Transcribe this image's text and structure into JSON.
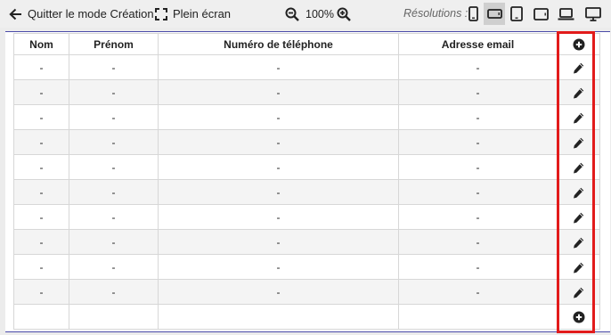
{
  "toolbar": {
    "exit_label": "Quitter le mode Création",
    "fullscreen_label": "Plein écran",
    "zoom_value": "100%",
    "resolutions_label": "Résolutions :",
    "resolution_options": [
      {
        "icon": "phone-portrait-icon",
        "active": false
      },
      {
        "icon": "phone-landscape-icon",
        "active": true
      },
      {
        "icon": "tablet-portrait-icon",
        "active": false
      },
      {
        "icon": "tablet-landscape-icon",
        "active": false
      },
      {
        "icon": "laptop-icon",
        "active": false
      },
      {
        "icon": "desktop-icon",
        "active": false
      }
    ]
  },
  "table": {
    "columns": [
      "Nom",
      "Prénom",
      "Numéro de téléphone",
      "Adresse email"
    ],
    "header_action_icon": "plus-circle-icon",
    "row_action_icon": "pencil-icon",
    "footer_action_icon": "plus-circle-icon",
    "rows": [
      [
        "-",
        "-",
        "-",
        "-"
      ],
      [
        "-",
        "-",
        "-",
        "-"
      ],
      [
        "-",
        "-",
        "-",
        "-"
      ],
      [
        "-",
        "-",
        "-",
        "-"
      ],
      [
        "-",
        "-",
        "-",
        "-"
      ],
      [
        "-",
        "-",
        "-",
        "-"
      ],
      [
        "-",
        "-",
        "-",
        "-"
      ],
      [
        "-",
        "-",
        "-",
        "-"
      ],
      [
        "-",
        "-",
        "-",
        "-"
      ],
      [
        "-",
        "-",
        "-",
        "-"
      ]
    ]
  },
  "colors": {
    "highlight": "#e21b1b",
    "active_resolution": "#cfcfcf",
    "canvas_border": "#4a4aa8"
  }
}
